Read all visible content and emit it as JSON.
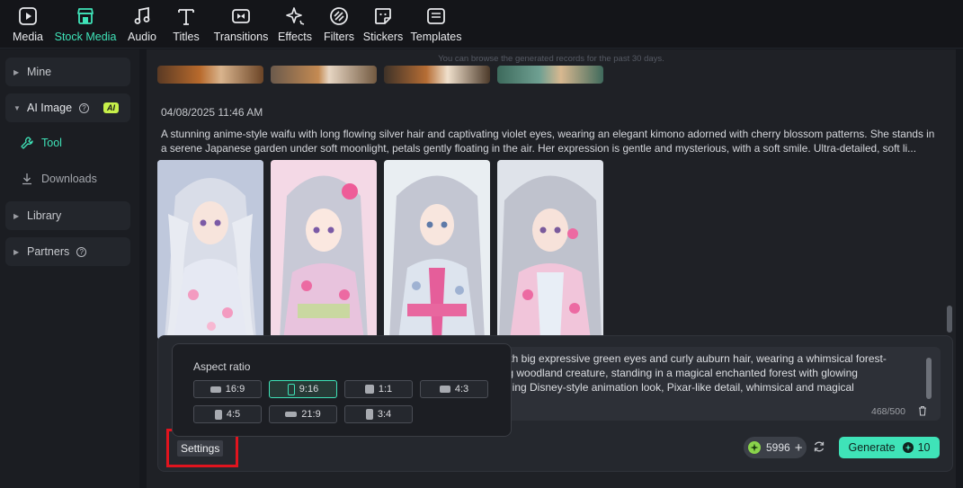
{
  "toolbar": {
    "items": [
      {
        "label": "Media",
        "icon": "media-icon"
      },
      {
        "label": "Stock Media",
        "icon": "stock-media-icon",
        "active": true
      },
      {
        "label": "Audio",
        "icon": "music-note-icon"
      },
      {
        "label": "Titles",
        "icon": "text-t-icon"
      },
      {
        "label": "Transitions",
        "icon": "transitions-icon"
      },
      {
        "label": "Effects",
        "icon": "effects-sparkle-icon"
      },
      {
        "label": "Filters",
        "icon": "filters-icon"
      },
      {
        "label": "Stickers",
        "icon": "sticker-icon"
      },
      {
        "label": "Templates",
        "icon": "templates-icon"
      }
    ],
    "accent": "#3fe3b8"
  },
  "sidebar": {
    "mine": "Mine",
    "ai_image": "AI Image",
    "ai_badge": "AI",
    "help": "?",
    "tool": "Tool",
    "downloads": "Downloads",
    "library": "Library",
    "partners": "Partners"
  },
  "main": {
    "hint": "You can browse the generated records for the past 30 days.",
    "record_date": "04/08/2025 11:46 AM",
    "record_prompt": "A stunning anime-style waifu with long flowing silver hair and captivating violet eyes, wearing an elegant kimono adorned with cherry blossom patterns. She stands in a serene Japanese garden under soft moonlight, petals gently floating in the air. Her expression is gentle and mysterious, with a soft smile. Ultra-detailed, soft li..."
  },
  "panel": {
    "prompt_lines": [
      "l with big expressive green eyes and curly auburn hair, wearing a whimsical forest-",
      "ving woodland creature, standing in a magical enchanted forest with glowing",
      "arming Disney-style animation look, Pixar-like detail, whimsical and magical"
    ],
    "char_count": "468/500",
    "settings_label": "Settings",
    "credits": "5996",
    "generate_label": "Generate",
    "generate_cost": "10"
  },
  "aspect_popup": {
    "title": "Aspect ratio",
    "options": [
      "16:9",
      "9:16",
      "1:1",
      "4:3",
      "4:5",
      "21:9",
      "3:4"
    ],
    "selected": "9:16"
  }
}
